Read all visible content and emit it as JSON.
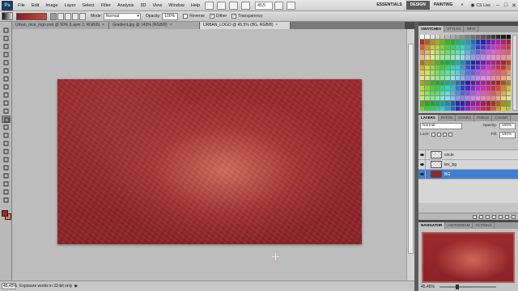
{
  "app": {
    "logo": "Ps"
  },
  "menu": [
    "File",
    "Edit",
    "Image",
    "Layer",
    "Select",
    "Filter",
    "Analysis",
    "3D",
    "View",
    "Window",
    "Help"
  ],
  "menubar": {
    "zoom": "45,5",
    "workspaces": [
      "ESSENTIALS",
      "DESIGN",
      "PAINTING"
    ],
    "active_workspace": "DESIGN",
    "cs_live": "CS Live",
    "window_controls": [
      "–",
      "□",
      "✕"
    ]
  },
  "options": {
    "mode_label": "Mode:",
    "mode_value": "Normal",
    "opacity_label": "Opacity:",
    "opacity_value": "100%",
    "reverse_label": "Reverse",
    "reverse_checked": false,
    "dither_label": "Dither",
    "dither_checked": true,
    "transparency_label": "Transparency",
    "transparency_checked": true,
    "gradient_colors": [
      "#8e1f1f",
      "#c44c40"
    ]
  },
  "tabs": [
    {
      "label": "Urban_nice_logo.psd @ 50% (Layer 2, RGB/8)",
      "active": false
    },
    {
      "label": "Gradient.jpg @ 143% (RGB/8)",
      "active": false
    },
    {
      "label": "URBAN_LOGO @ 45,5% (BG, RGB/8)",
      "active": true
    }
  ],
  "tab_close": "×",
  "canvas": {
    "colors": {
      "base": "#92272a",
      "glow": "#e0826e"
    }
  },
  "colors": {
    "foreground": "#a02a2a",
    "background": "#e07d5b"
  },
  "status": {
    "zoom": "45,45%",
    "message": "Exposure works in 32-bit only",
    "arrow": "▶"
  },
  "swatches_panel": {
    "tabs": [
      "SWATCHES",
      "STYLES",
      "INFO"
    ],
    "active": "SWATCHES"
  },
  "layers_panel": {
    "tabs": [
      "LAYERS",
      "PATHS",
      "CHARA",
      "PARAG",
      "CHANR"
    ],
    "active": "LAYERS",
    "blend_mode": "Normal",
    "opacity_label": "Opacity:",
    "opacity_value": "100%",
    "lock_label": "Lock:",
    "fill_label": "Fill:",
    "fill_value": "100%",
    "layers": [
      {
        "name": "circle",
        "selected": false
      },
      {
        "name": "tex_bg",
        "selected": false
      },
      {
        "name": "BG",
        "selected": true
      }
    ]
  },
  "navigator_panel": {
    "tabs": [
      "NAVIGATOR",
      "HISTOGRAM",
      "ACTIONS"
    ],
    "active": "NAVIGATOR",
    "zoom": "45,45%"
  }
}
